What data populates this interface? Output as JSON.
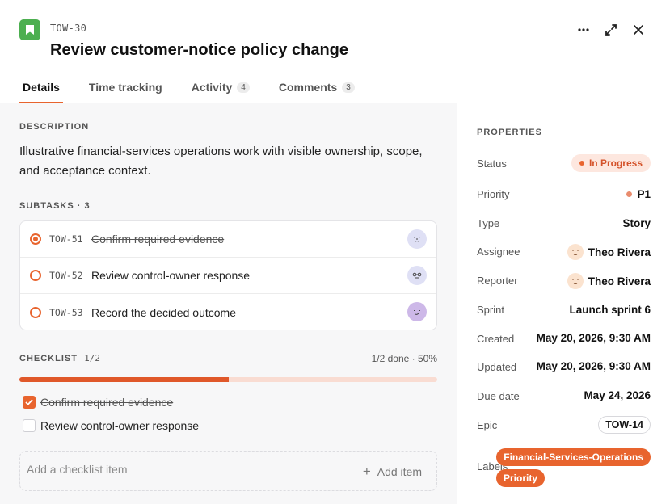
{
  "issue": {
    "key": "TOW-30",
    "title": "Review customer-notice policy change",
    "type_icon": "bookmark-icon"
  },
  "header_actions": [
    "more-icon",
    "expand-icon",
    "close-icon"
  ],
  "tabs": [
    {
      "label": "Details",
      "count": null,
      "active": true
    },
    {
      "label": "Time tracking",
      "count": null,
      "active": false
    },
    {
      "label": "Activity",
      "count": "4",
      "active": false
    },
    {
      "label": "Comments",
      "count": "3",
      "active": false
    }
  ],
  "description": {
    "heading": "DESCRIPTION",
    "text": "Illustrative financial-services operations work with visible ownership, scope, and acceptance context."
  },
  "subtasks": {
    "heading": "SUBTASKS · 3",
    "items": [
      {
        "key": "TOW-51",
        "text": "Confirm required evidence",
        "done": true
      },
      {
        "key": "TOW-52",
        "text": "Review control-owner response",
        "done": false
      },
      {
        "key": "TOW-53",
        "text": "Record the decided outcome",
        "done": false
      }
    ]
  },
  "checklist": {
    "heading": "CHECKLIST",
    "count": "1/2",
    "summary": "1/2 done · 50%",
    "progress": 0.5,
    "items": [
      {
        "text": "Confirm required evidence",
        "checked": true
      },
      {
        "text": "Review control-owner response",
        "checked": false
      }
    ],
    "add_placeholder": "Add a checklist item",
    "add_label": "Add item"
  },
  "properties": {
    "heading": "PROPERTIES",
    "status": {
      "label": "Status",
      "value": "In Progress"
    },
    "priority": {
      "label": "Priority",
      "value": "P1"
    },
    "type": {
      "label": "Type",
      "value": "Story"
    },
    "assignee": {
      "label": "Assignee",
      "value": "Theo Rivera"
    },
    "reporter": {
      "label": "Reporter",
      "value": "Theo Rivera"
    },
    "sprint": {
      "label": "Sprint",
      "value": "Launch sprint 6"
    },
    "created": {
      "label": "Created",
      "value": "May 20, 2026, 9:30 AM"
    },
    "updated": {
      "label": "Updated",
      "value": "May 20, 2026, 9:30 AM"
    },
    "due": {
      "label": "Due date",
      "value": "May 24, 2026"
    },
    "epic": {
      "label": "Epic",
      "value": "TOW-14"
    },
    "labels": {
      "label": "Labels",
      "values": [
        "Financial-Services-Operations",
        "Priority"
      ]
    }
  },
  "colors": {
    "accent": "#e8642e",
    "type_badge": "#4caf50",
    "status_bg": "#fde7df"
  }
}
